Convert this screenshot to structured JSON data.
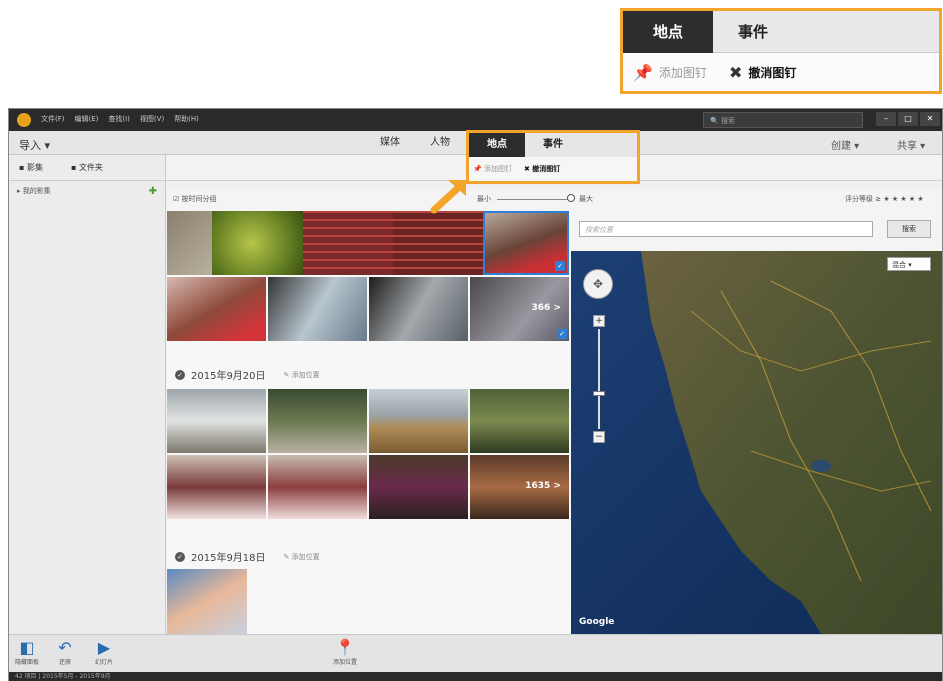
{
  "callout": {
    "tabs": [
      "地点",
      "事件"
    ],
    "add_pin": "添加图钉",
    "remove_pin": "撤消图钉"
  },
  "titlebar": {
    "menus": [
      "文件(F)",
      "编辑(E)",
      "查找(I)",
      "视图(V)",
      "帮助(H)"
    ],
    "search_placeholder": "搜索"
  },
  "toolbar": {
    "import": "导入",
    "tabs": [
      "媒体",
      "人物",
      "地点",
      "事件"
    ],
    "create": "创建",
    "share": "共享"
  },
  "sidebar": {
    "tab_albums": "影集",
    "tab_folders": "文件夹",
    "my_albums": "我的影集"
  },
  "options": {
    "time_group": "按时间分组",
    "zoom_min": "最小",
    "zoom_max": "最大",
    "rating_label": "评分等级",
    "rating_ge": "≥"
  },
  "grid": {
    "more1": "366 >",
    "date1": "2015年9月20日",
    "add_location": "添加位置",
    "more2": "1635 >",
    "date2": "2015年9月18日"
  },
  "map": {
    "search_placeholder": "搜索位置",
    "search_button": "搜索",
    "type_select": "混合"
  },
  "bottombar": {
    "hide_panel": "隐藏面板",
    "undo": "还原",
    "slideshow": "幻灯片",
    "add_location": "添加位置"
  },
  "status": "42 项目 | 2015年5月 - 2015年9月",
  "colors": {
    "highlight": "#f3a42a",
    "active_tab": "#2d2d2d",
    "accent_blue": "#2b6cb0"
  }
}
